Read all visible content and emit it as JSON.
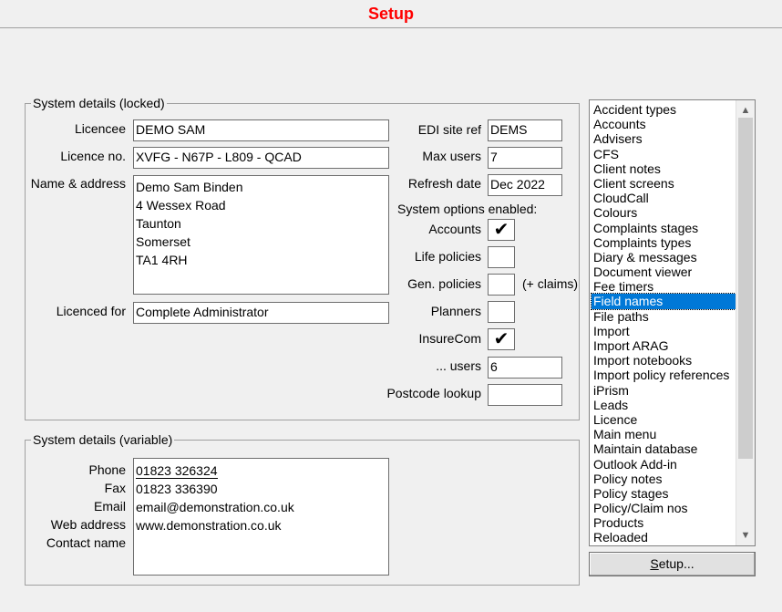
{
  "window": {
    "title": "Setup"
  },
  "locked": {
    "group_title": "System details (locked)",
    "licencee_label": "Licencee",
    "licencee_value": "DEMO SAM",
    "licence_no_label": "Licence no.",
    "licence_no_value": "XVFG - N67P - L809 - QCAD",
    "name_address_label": "Name & address",
    "address_lines": [
      "Demo Sam Binden",
      "4 Wessex Road",
      "Taunton",
      "Somerset",
      "TA1 4RH"
    ],
    "licenced_for_label": "Licenced for",
    "licenced_for_value": "Complete Administrator",
    "edi_label": "EDI site ref",
    "edi_value": "DEMS",
    "max_users_label": "Max users",
    "max_users_value": "7",
    "refresh_label": "Refresh date",
    "refresh_value": "Dec 2022",
    "options_label": "System options enabled:",
    "accounts_label": "Accounts",
    "accounts_checked": "✔",
    "life_label": "Life policies",
    "gen_label": "Gen. policies",
    "claims_label": "(+ claims)",
    "planners_label": "Planners",
    "insurecom_label": "InsureCom",
    "insurecom_checked": "✔",
    "users_label": "... users",
    "users_value": "6",
    "postcode_label": "Postcode lookup",
    "postcode_value": ""
  },
  "variable": {
    "group_title": "System details (variable)",
    "phone_label": "Phone",
    "fax_label": "Fax",
    "email_label": "Email",
    "web_label": "Web address",
    "contact_label": "Contact name",
    "phone_value": "01823 326324",
    "fax_value": "01823 336390",
    "email_value": "email@demonstration.co.uk",
    "web_value": "www.demonstration.co.uk",
    "contact_value": ""
  },
  "setup_list": {
    "items": [
      "Accident types",
      "Accounts",
      "Advisers",
      "CFS",
      "Client notes",
      "Client screens",
      "CloudCall",
      "Colours",
      "Complaints stages",
      "Complaints types",
      "Diary & messages",
      "Document viewer",
      "Fee timers",
      "Field names",
      "File paths",
      "Import",
      "Import ARAG",
      "Import notebooks",
      "Import policy references",
      "iPrism",
      "Leads",
      "Licence",
      "Main menu",
      "Maintain database",
      "Outlook Add-in",
      "Policy notes",
      "Policy stages",
      "Policy/Claim nos",
      "Products",
      "Reloaded"
    ],
    "selected": "Field names"
  },
  "setup_button": {
    "label_underlined": "S",
    "label_rest": "etup..."
  }
}
